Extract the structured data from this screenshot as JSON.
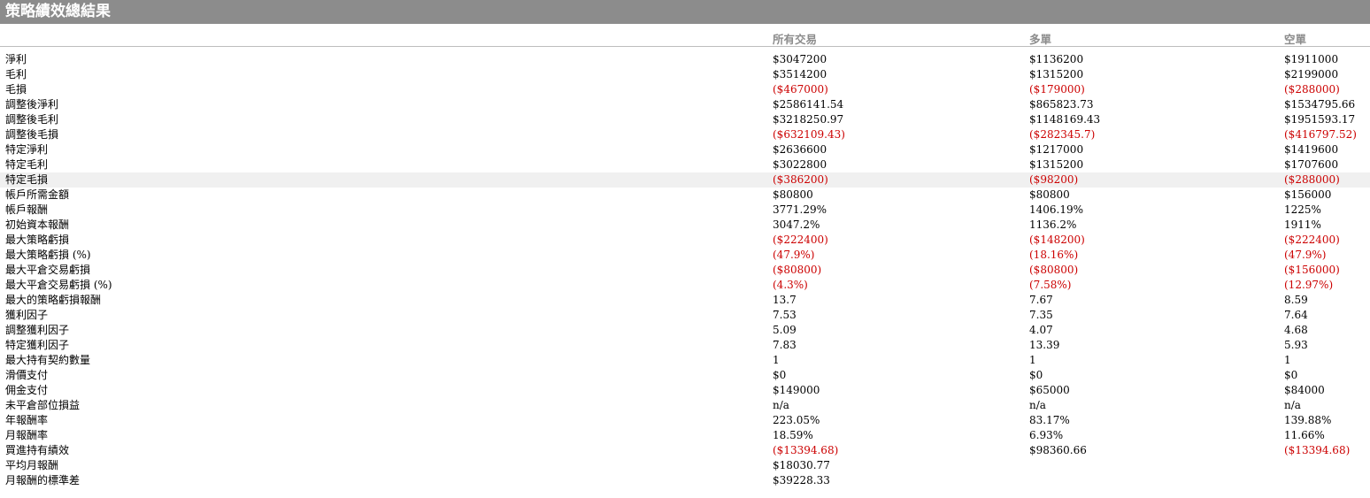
{
  "title": "策略績效總結果",
  "columns": {
    "all": "所有交易",
    "long": "多單",
    "short": "空單"
  },
  "highlight_color": "#f0f0f0",
  "negative_color": "#cc0000",
  "rows": [
    {
      "label": "淨利",
      "all": "$3047200",
      "long": "$1136200",
      "short": "$1911000",
      "neg": [
        false,
        false,
        false
      ]
    },
    {
      "label": "毛利",
      "all": "$3514200",
      "long": "$1315200",
      "short": "$2199000",
      "neg": [
        false,
        false,
        false
      ]
    },
    {
      "label": "毛損",
      "all": "($467000)",
      "long": "($179000)",
      "short": "($288000)",
      "neg": [
        true,
        true,
        true
      ]
    },
    {
      "label": "調整後淨利",
      "all": "$2586141.54",
      "long": "$865823.73",
      "short": "$1534795.66",
      "neg": [
        false,
        false,
        false
      ]
    },
    {
      "label": "調整後毛利",
      "all": "$3218250.97",
      "long": "$1148169.43",
      "short": "$1951593.17",
      "neg": [
        false,
        false,
        false
      ]
    },
    {
      "label": "調整後毛損",
      "all": "($632109.43)",
      "long": "($282345.7)",
      "short": "($416797.52)",
      "neg": [
        true,
        true,
        true
      ]
    },
    {
      "label": "特定淨利",
      "all": "$2636600",
      "long": "$1217000",
      "short": "$1419600",
      "neg": [
        false,
        false,
        false
      ]
    },
    {
      "label": "特定毛利",
      "all": "$3022800",
      "long": "$1315200",
      "short": "$1707600",
      "neg": [
        false,
        false,
        false
      ]
    },
    {
      "label": "特定毛損",
      "all": "($386200)",
      "long": "($98200)",
      "short": "($288000)",
      "neg": [
        true,
        true,
        true
      ],
      "highlight": true
    },
    {
      "label": "帳戶所需金額",
      "all": "$80800",
      "long": "$80800",
      "short": "$156000",
      "neg": [
        false,
        false,
        false
      ]
    },
    {
      "label": "帳戶報酬",
      "all": "3771.29%",
      "long": "1406.19%",
      "short": "1225%",
      "neg": [
        false,
        false,
        false
      ]
    },
    {
      "label": "初始資本報酬",
      "all": "3047.2%",
      "long": "1136.2%",
      "short": "1911%",
      "neg": [
        false,
        false,
        false
      ]
    },
    {
      "label": "最大策略虧損",
      "all": "($222400)",
      "long": "($148200)",
      "short": "($222400)",
      "neg": [
        true,
        true,
        true
      ]
    },
    {
      "label": "最大策略虧損 (%)",
      "all": "(47.9%)",
      "long": "(18.16%)",
      "short": "(47.9%)",
      "neg": [
        true,
        true,
        true
      ]
    },
    {
      "label": "最大平倉交易虧損",
      "all": "($80800)",
      "long": "($80800)",
      "short": "($156000)",
      "neg": [
        true,
        true,
        true
      ]
    },
    {
      "label": "最大平倉交易虧損 (%)",
      "all": "(4.3%)",
      "long": "(7.58%)",
      "short": "(12.97%)",
      "neg": [
        true,
        true,
        true
      ]
    },
    {
      "label": "最大的策略虧損報酬",
      "all": "13.7",
      "long": "7.67",
      "short": "8.59",
      "neg": [
        false,
        false,
        false
      ]
    },
    {
      "label": "獲利因子",
      "all": "7.53",
      "long": "7.35",
      "short": "7.64",
      "neg": [
        false,
        false,
        false
      ]
    },
    {
      "label": "調整獲利因子",
      "all": "5.09",
      "long": "4.07",
      "short": "4.68",
      "neg": [
        false,
        false,
        false
      ]
    },
    {
      "label": "特定獲利因子",
      "all": "7.83",
      "long": "13.39",
      "short": "5.93",
      "neg": [
        false,
        false,
        false
      ]
    },
    {
      "label": "最大持有契約數量",
      "all": "1",
      "long": "1",
      "short": "1",
      "neg": [
        false,
        false,
        false
      ]
    },
    {
      "label": "滑價支付",
      "all": "$0",
      "long": "$0",
      "short": "$0",
      "neg": [
        false,
        false,
        false
      ]
    },
    {
      "label": "佣金支付",
      "all": "$149000",
      "long": "$65000",
      "short": "$84000",
      "neg": [
        false,
        false,
        false
      ]
    },
    {
      "label": "未平倉部位損益",
      "all": "n/a",
      "long": "n/a",
      "short": "n/a",
      "neg": [
        false,
        false,
        false
      ]
    },
    {
      "label": "年報酬率",
      "all": "223.05%",
      "long": "83.17%",
      "short": "139.88%",
      "neg": [
        false,
        false,
        false
      ]
    },
    {
      "label": "月報酬率",
      "all": "18.59%",
      "long": "6.93%",
      "short": "11.66%",
      "neg": [
        false,
        false,
        false
      ]
    },
    {
      "label": "買進持有績效",
      "all": "($13394.68)",
      "long": "$98360.66",
      "short": "($13394.68)",
      "neg": [
        true,
        false,
        true
      ]
    },
    {
      "label": "平均月報酬",
      "all": "$18030.77",
      "long": "",
      "short": "",
      "neg": [
        false,
        false,
        false
      ]
    },
    {
      "label": "月報酬的標準差",
      "all": "$39228.33",
      "long": "",
      "short": "",
      "neg": [
        false,
        false,
        false
      ]
    }
  ]
}
